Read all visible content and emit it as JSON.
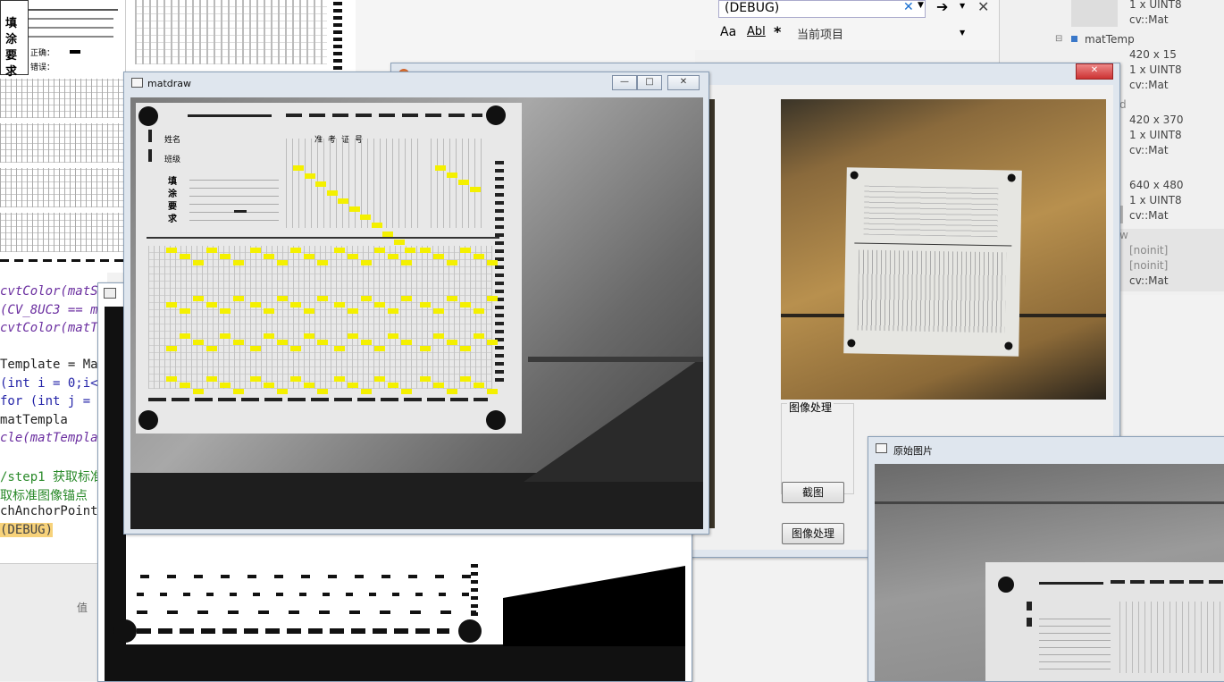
{
  "code_lines": [
    {
      "text": "cvtColor(matS",
      "style": "ty"
    },
    {
      "text": "(CV_8UC3 == ma",
      "style": "ty"
    },
    {
      "text": "cvtColor(matT",
      "style": "ty"
    },
    {
      "text": "",
      "style": ""
    },
    {
      "text": "Template = Mat",
      "style": ""
    },
    {
      "text": "(int i = 0;i<",
      "style": "kw"
    },
    {
      "text": "for (int j =",
      "style": "kw"
    },
    {
      "text": "    matTempla",
      "style": ""
    },
    {
      "text": "cle(matTemplat",
      "style": "ty"
    },
    {
      "text": "",
      "style": ""
    },
    {
      "text": "/step1 获取标准",
      "style": "cm"
    },
    {
      "text": "取标准图像锚点",
      "style": "cm"
    },
    {
      "text": "chAnchorPoints",
      "style": ""
    },
    {
      "text": "(DEBUG)",
      "style": "hl"
    }
  ],
  "code_status": "值",
  "toolbar": {
    "config_value": "(DEBUG)",
    "font_label": "Aa",
    "abl_label": "Abl",
    "star_label": "*",
    "scope_label": "当前项目"
  },
  "watch": {
    "top_type": "1 x UINT8",
    "top_class": "cv::Mat",
    "mattemp_label": "matTemp",
    "mattemp_size": "420 x 15",
    "mattemp_type": "1 x UINT8",
    "mattemp_class": "cv::Mat",
    "partial_label": "d",
    "item2_size": "420 x 370",
    "item2_type": "1 x UINT8",
    "item2_class": "cv::Mat",
    "item3_size": "640 x 480",
    "item3_type": "1 x UINT8",
    "item3_class": "cv::Mat",
    "item4_label": "w",
    "noinit1": "[noinit]",
    "noinit2": "[noinit]",
    "item4_class": "cv::Mat"
  },
  "matdraw": {
    "title": "matdraw",
    "min": "—",
    "max": "□",
    "close": "✕"
  },
  "main_dialog": {
    "close": "✕",
    "group_label": "图像处理",
    "btn_capture": "截图",
    "btn_process": "图像处理"
  },
  "original": {
    "title": "原始图片"
  },
  "sheet": {
    "name_label": "姓名",
    "class_label": "班级",
    "exam_label": "准考证号",
    "fill_label": "填涂要求",
    "correct_label": "正确：",
    "wrong_label": "错误："
  }
}
